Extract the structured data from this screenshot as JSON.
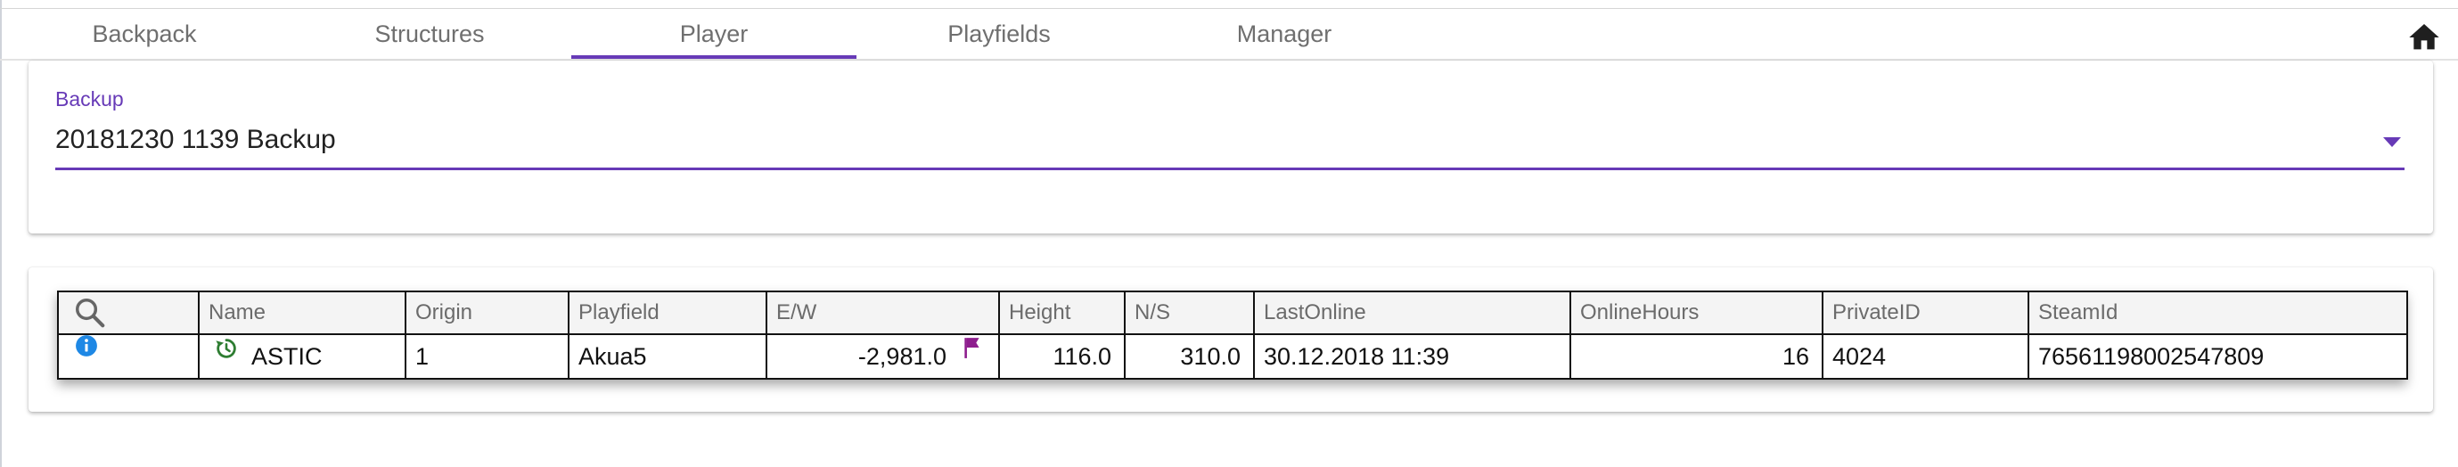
{
  "tabs": [
    {
      "label": "Backpack"
    },
    {
      "label": "Structures"
    },
    {
      "label": "Player"
    },
    {
      "label": "Playfields"
    },
    {
      "label": "Manager"
    }
  ],
  "active_tab": "Player",
  "backup": {
    "label": "Backup",
    "value": "20181230 1139 Backup"
  },
  "table": {
    "columns": [
      "Name",
      "Origin",
      "Playfield",
      "E/W",
      "Height",
      "N/S",
      "LastOnline",
      "OnlineHours",
      "PrivateID",
      "SteamId"
    ],
    "rows": [
      {
        "name": "ASTIC",
        "origin": "1",
        "playfield": "Akua5",
        "ew": "-2,981.0",
        "height": "116.0",
        "ns": "310.0",
        "last_online": "30.12.2018 11:39",
        "online_hours": "16",
        "private_id": "4024",
        "steam_id": "76561198002547809"
      }
    ]
  },
  "colors": {
    "accent": "#673ab7",
    "info": "#1e88e5",
    "restore": "#2e7d32",
    "flag": "#8e1e8e"
  },
  "icons": [
    "home-icon",
    "chevron-down-icon",
    "search-icon",
    "info-icon",
    "restore-icon",
    "flag-icon"
  ]
}
